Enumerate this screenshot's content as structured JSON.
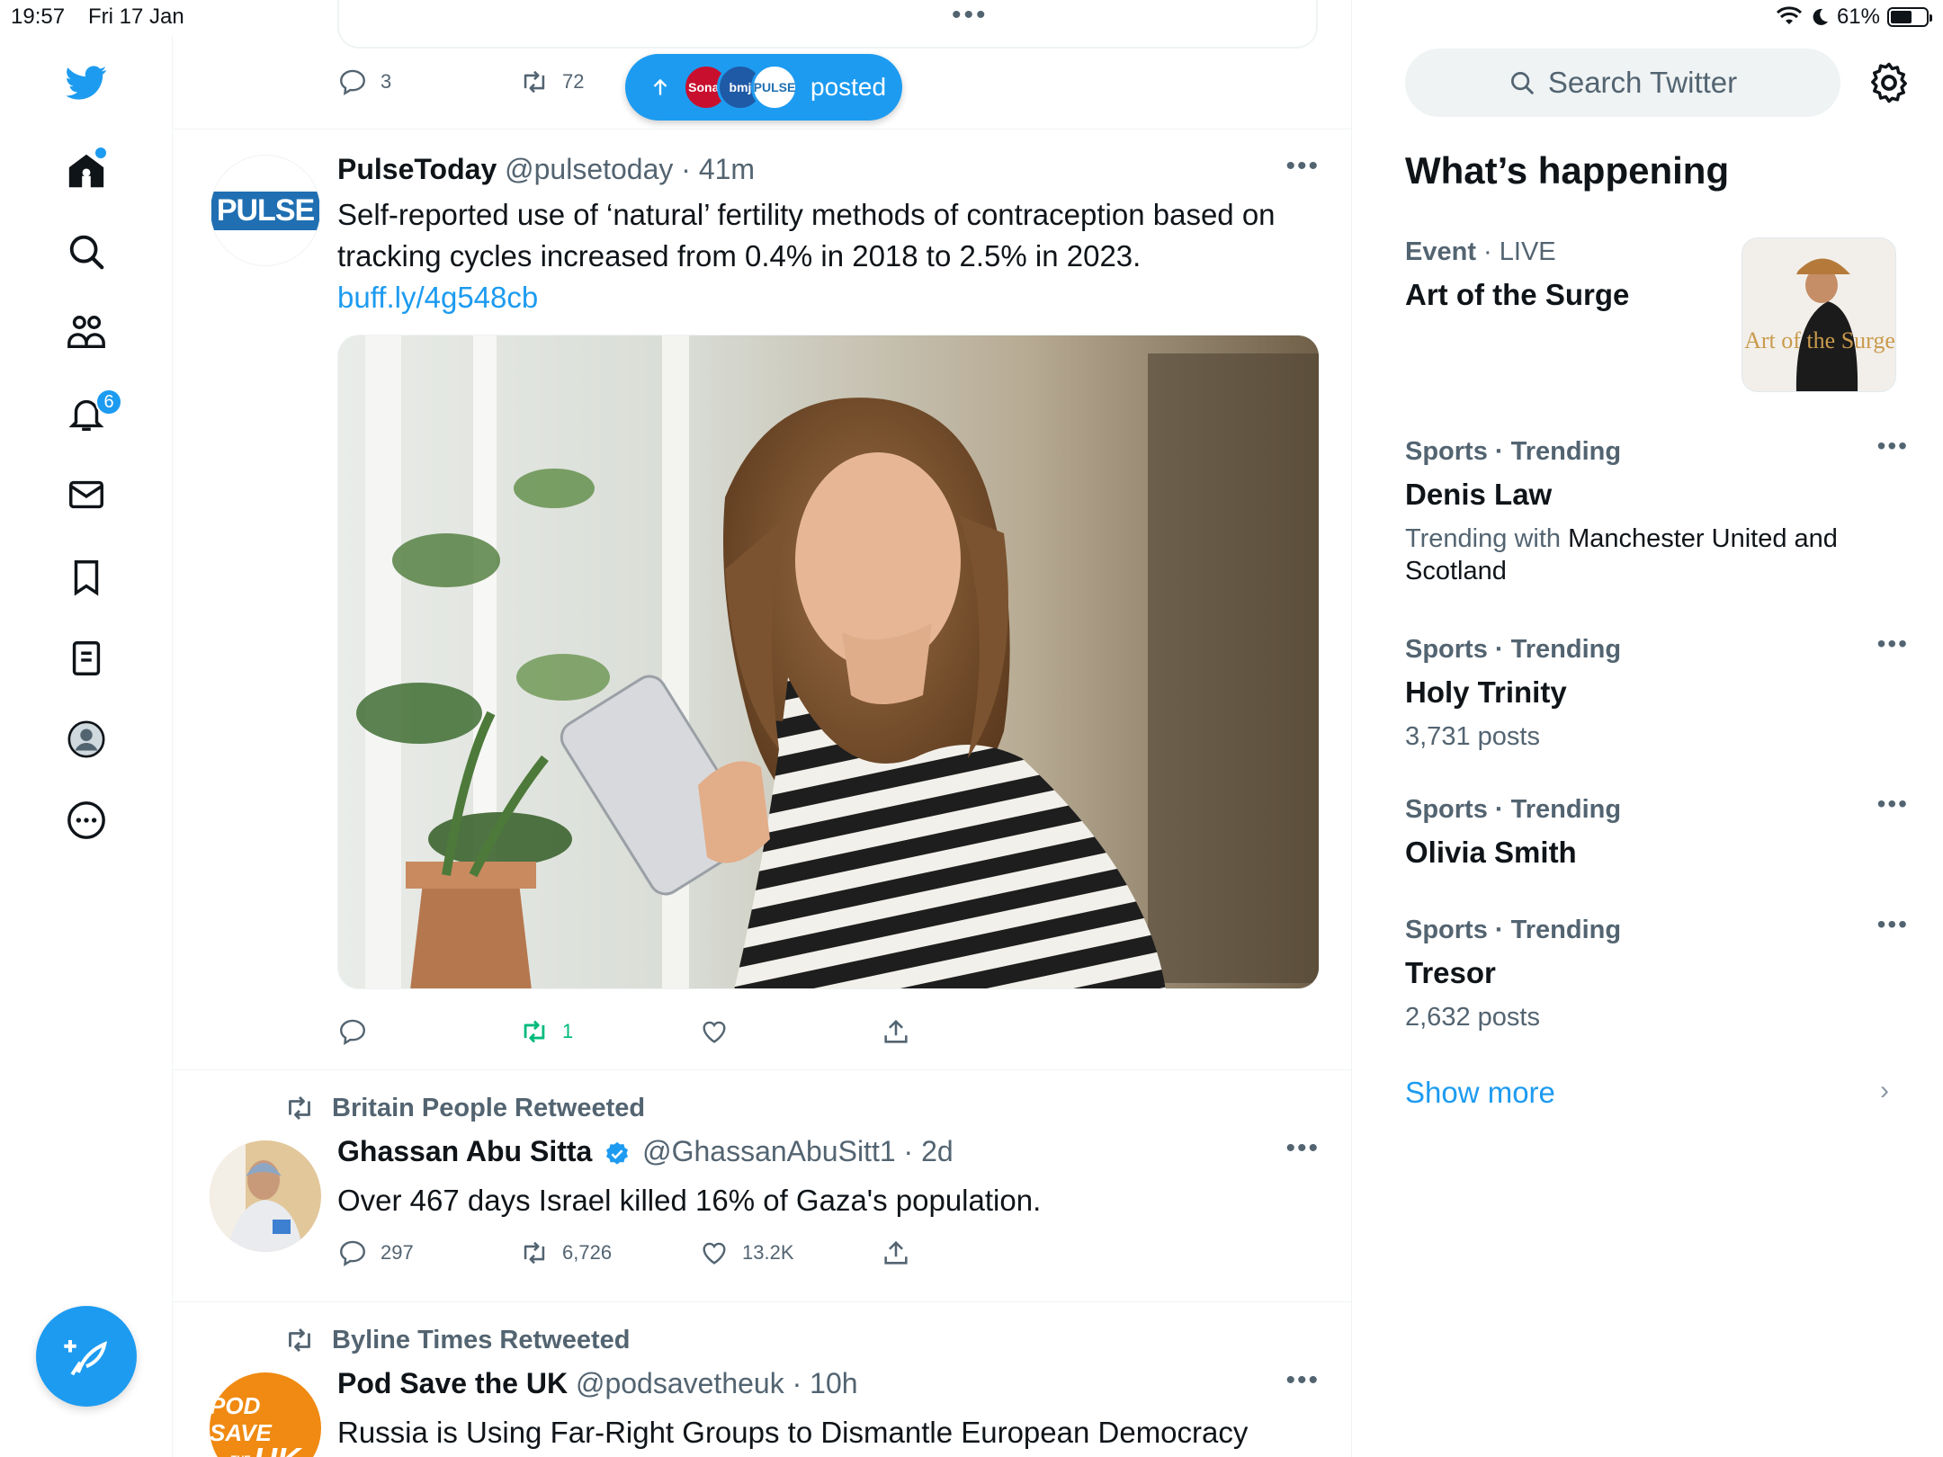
{
  "status_bar": {
    "time": "19:57",
    "date": "Fri 17 Jan",
    "battery_percent": "61%",
    "battery_level": 0.61
  },
  "nav": {
    "notifications_badge": "6",
    "items": [
      "home",
      "explore",
      "communities",
      "notifications",
      "messages",
      "bookmarks",
      "lists",
      "profile",
      "more"
    ]
  },
  "prev_tweet": {
    "replies": "3",
    "retweets": "72",
    "posted_pill": {
      "label": "posted",
      "avatars": [
        "Sonar",
        "bmj",
        "PULSE"
      ]
    }
  },
  "tweets": [
    {
      "name": "PulseToday",
      "handle": "@pulsetoday",
      "time": "· 41m",
      "avatar_text": "PULSE",
      "text": "Self-reported use of ‘natural’ fertility methods of contraception based on tracking cycles increased from 0.4% in 2018 to 2.5% in 2023.",
      "link": "buff.ly/4g548cb",
      "retweets": "1"
    },
    {
      "retweeted_by": "Britain People Retweeted",
      "name": "Ghassan Abu Sitta",
      "handle": "@GhassanAbuSitt1",
      "time": "· 2d",
      "text": "Over 467 days Israel killed 16% of Gaza's population.",
      "replies": "297",
      "retweets": "6,726",
      "likes": "13.2K"
    },
    {
      "retweeted_by": "Byline Times Retweeted",
      "name": "Pod Save the UK",
      "handle": "@podsavetheuk",
      "time": "· 10h",
      "avatar_text_top": "POD SAVE",
      "avatar_text_bottom": "UK",
      "avatar_text_small": "THE",
      "text": "Russia is Using Far-Right Groups to Dismantle European Democracy"
    }
  ],
  "sidebar": {
    "search_placeholder": "Search Twitter",
    "title": "What’s happening",
    "event": {
      "category": "Event",
      "live": "· LIVE",
      "name": "Art of the Surge",
      "image_text": "Art of the Surge"
    },
    "trends": [
      {
        "context": "Sports · Trending",
        "name": "Denis Law",
        "sub_prefix": "Trending with",
        "sub_main": "Manchester United and Scotland"
      },
      {
        "context": "Sports · Trending",
        "name": "Holy Trinity",
        "sub": "3,731 posts"
      },
      {
        "context": "Sports · Trending",
        "name": "Olivia Smith"
      },
      {
        "context": "Sports · Trending",
        "name": "Tresor",
        "sub": "2,632 posts"
      }
    ],
    "show_more": "Show more"
  },
  "colors": {
    "accent": "#1d9bf0",
    "retweet_green": "#00ba7c",
    "muted": "#536471"
  }
}
